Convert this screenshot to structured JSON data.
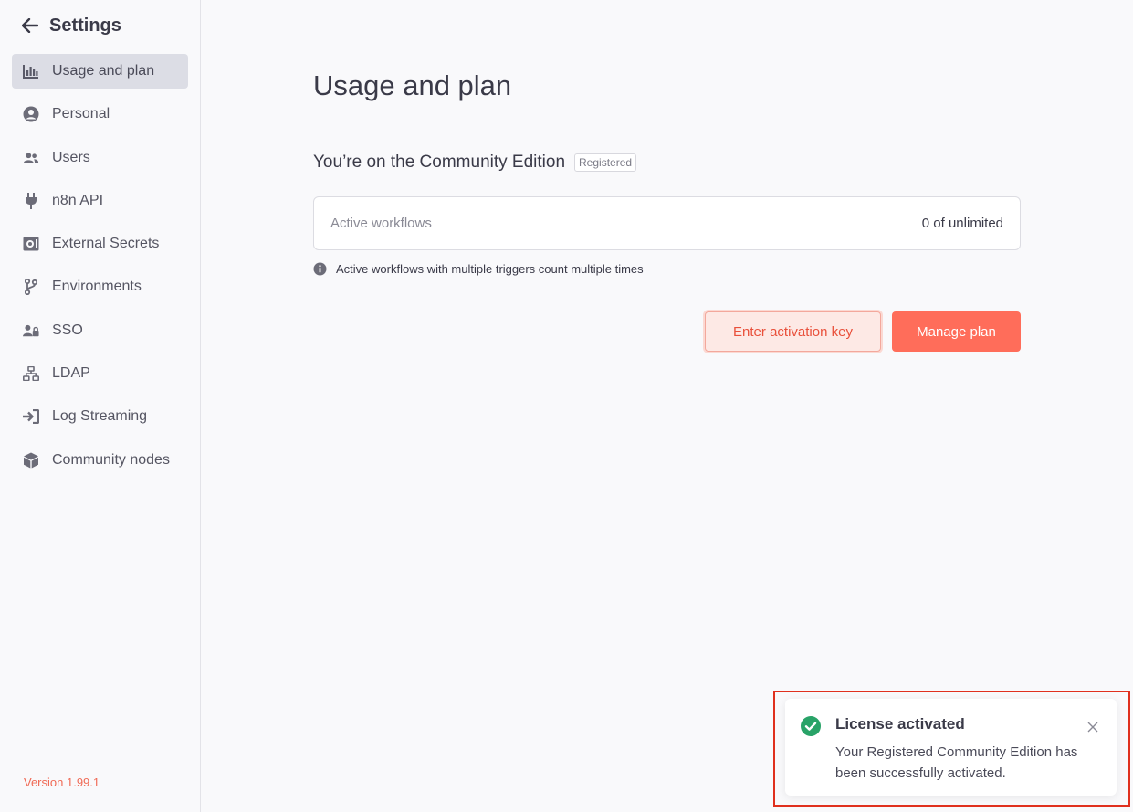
{
  "sidebar": {
    "title": "Settings",
    "items": [
      {
        "label": "Usage and plan",
        "icon": "chart-bar-icon",
        "active": true
      },
      {
        "label": "Personal",
        "icon": "user-circle-icon"
      },
      {
        "label": "Users",
        "icon": "users-icon"
      },
      {
        "label": "n8n API",
        "icon": "plug-icon"
      },
      {
        "label": "External Secrets",
        "icon": "vault-icon"
      },
      {
        "label": "Environments",
        "icon": "code-branch-icon"
      },
      {
        "label": "SSO",
        "icon": "user-lock-icon"
      },
      {
        "label": "LDAP",
        "icon": "network-icon"
      },
      {
        "label": "Log Streaming",
        "icon": "sign-in-icon"
      },
      {
        "label": "Community nodes",
        "icon": "cube-icon"
      }
    ],
    "version": "Version 1.99.1"
  },
  "main": {
    "title": "Usage and plan",
    "edition_text": "You’re on the Community Edition",
    "edition_badge": "Registered",
    "usage": {
      "label": "Active workflows",
      "value": "0 of unlimited"
    },
    "info_text": "Active workflows with multiple triggers count multiple times",
    "buttons": {
      "activation": "Enter activation key",
      "manage": "Manage plan"
    }
  },
  "toast": {
    "title": "License activated",
    "body": "Your Registered Community Edition has been successfully activated.",
    "icon": "check-circle-icon"
  },
  "colors": {
    "accent": "#ff6d5a",
    "success": "#29a368",
    "highlight": "#e0301e"
  }
}
